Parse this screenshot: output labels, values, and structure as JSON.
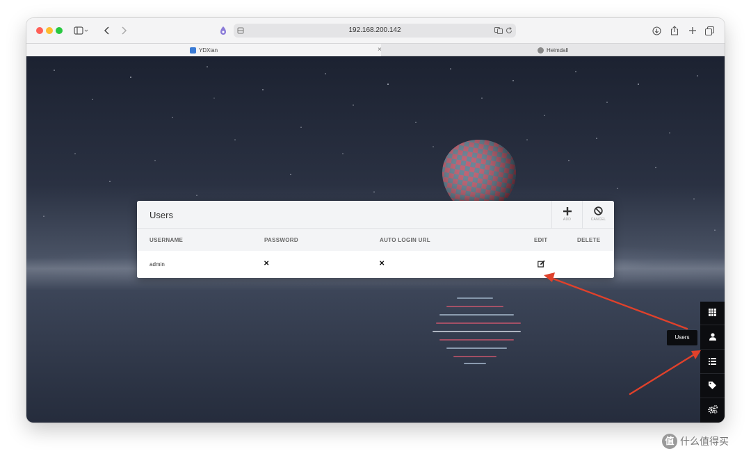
{
  "browser": {
    "url": "192.168.200.142",
    "tabs": [
      {
        "label": "YDXian",
        "active": true
      },
      {
        "label": "Heimdall",
        "active": false
      }
    ]
  },
  "users_panel": {
    "title": "Users",
    "add_label": "ADD",
    "cancel_label": "CANCEL",
    "columns": [
      "USERNAME",
      "PASSWORD",
      "AUTO LOGIN URL",
      "EDIT",
      "DELETE"
    ],
    "rows": [
      {
        "username": "admin",
        "password": "✕",
        "auto_login_url": "✕",
        "edit": "edit-icon",
        "delete": ""
      }
    ]
  },
  "sidebar": {
    "items": [
      {
        "icon": "grid-icon",
        "label": "Applications"
      },
      {
        "icon": "user-icon",
        "label": "Users"
      },
      {
        "icon": "list-icon",
        "label": "Items"
      },
      {
        "icon": "tag-icon",
        "label": "Tags"
      },
      {
        "icon": "settings-icon",
        "label": "Settings"
      }
    ],
    "tooltip": "Users"
  },
  "colors": {
    "annotation_arrow": "#e0412b",
    "sidebar_bg": "#0c0d10"
  },
  "watermark": {
    "text": "什么值得买",
    "badge": "值"
  }
}
